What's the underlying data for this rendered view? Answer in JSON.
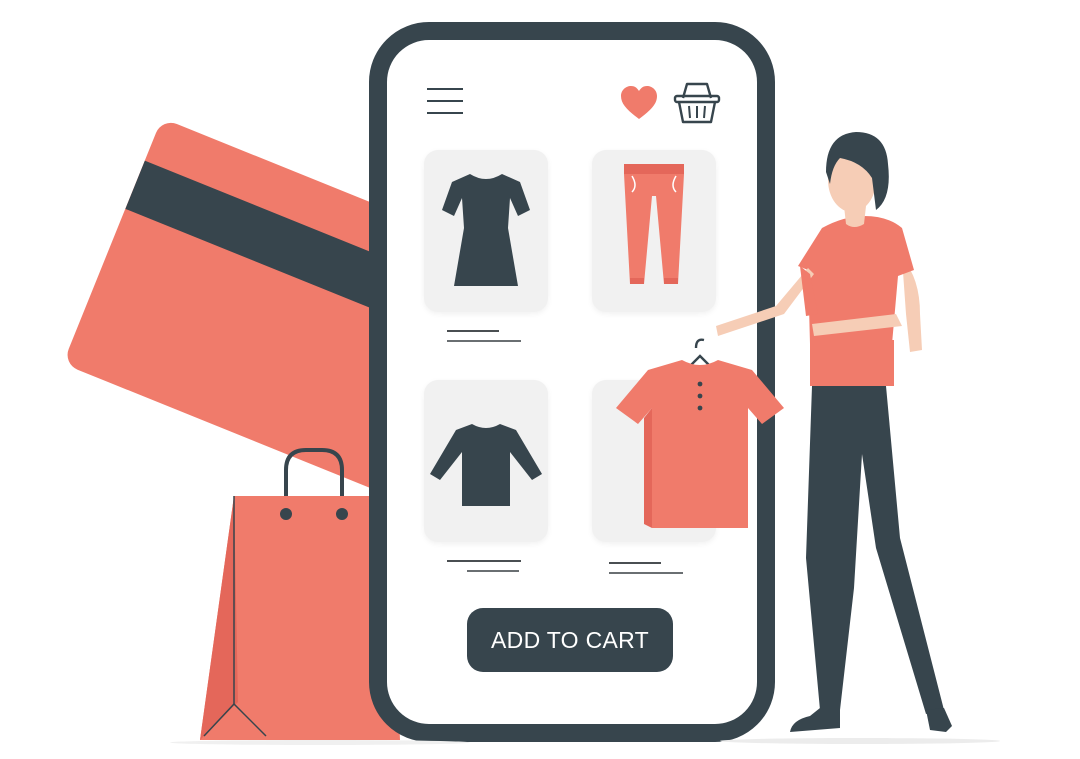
{
  "colors": {
    "accent": "#f07b6b",
    "accent_dark": "#e4675a",
    "dark": "#37454d",
    "skin": "#f6cdb6",
    "tile_bg": "#f1f1f1"
  },
  "phone": {
    "header": {
      "menu_icon": "hamburger-menu-icon",
      "wishlist_icon": "heart-icon",
      "cart_icon": "shopping-basket-icon"
    },
    "products": [
      {
        "icon": "dress-icon"
      },
      {
        "icon": "pants-icon"
      },
      {
        "icon": "long-sleeve-shirt-icon"
      },
      {
        "icon": "t-shirt-icon"
      }
    ],
    "add_to_cart_label": "ADD TO CART"
  },
  "illustration": {
    "credit_card_icon": "credit-card-icon",
    "shopping_bag_icon": "shopping-bag-icon",
    "person": "woman-shopper",
    "held_item_icon": "t-shirt-on-hanger-icon"
  }
}
